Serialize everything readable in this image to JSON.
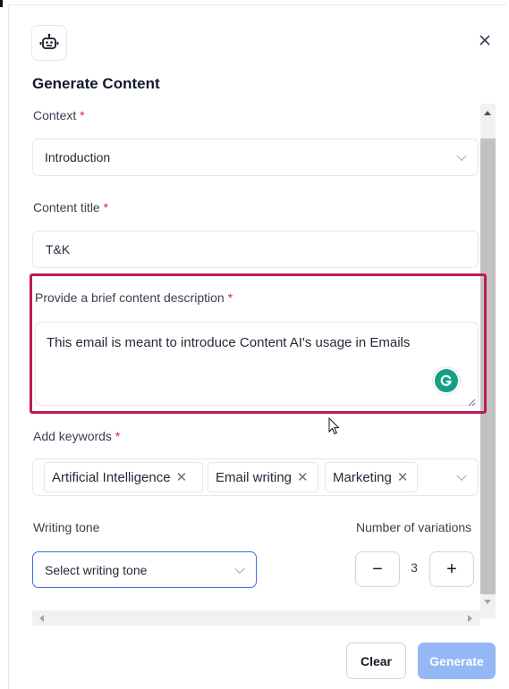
{
  "dialog": {
    "title": "Generate Content",
    "close_icon": "close-icon",
    "header_icon": "robot-icon"
  },
  "context": {
    "label": "Context",
    "required_mark": "*",
    "value": "Introduction"
  },
  "content_title": {
    "label": "Content title",
    "required_mark": "*",
    "value": "T&K"
  },
  "description": {
    "label": "Provide a brief content description",
    "required_mark": "*",
    "value": "This email is meant to introduce Content AI's usage in Emails",
    "assistant_icon": "grammarly-icon"
  },
  "keywords": {
    "label": "Add keywords",
    "required_mark": "*",
    "chips": [
      "Artificial Intelligence",
      "Email writing",
      "Marketing"
    ],
    "remove_glyph": "✕"
  },
  "writing_tone": {
    "label": "Writing tone",
    "placeholder": "Select writing tone"
  },
  "variations": {
    "label": "Number of variations",
    "value": "3",
    "decrement": "−",
    "increment": "+"
  },
  "footer": {
    "clear_label": "Clear",
    "generate_label": "Generate"
  },
  "colors": {
    "highlight": "#c2185b",
    "required": "#dc2626",
    "focus_border": "#3b6fd9",
    "generate_disabled": "#93b8f5",
    "grammarly": "#15a085"
  }
}
